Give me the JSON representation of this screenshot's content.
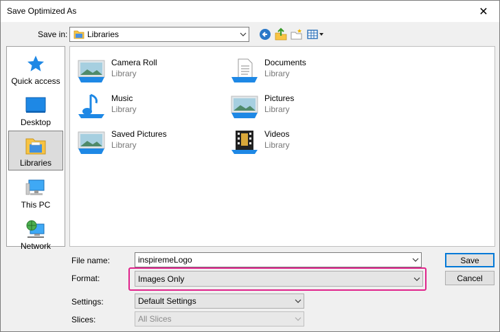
{
  "window": {
    "title": "Save Optimized As",
    "close_glyph": "✕"
  },
  "toolbar": {
    "save_in_label": "Save in:",
    "location": "Libraries",
    "icons": [
      "back-icon",
      "up-folder-icon",
      "new-folder-icon",
      "view-menu-icon"
    ]
  },
  "places": [
    {
      "label": "Quick access",
      "icon": "star-icon"
    },
    {
      "label": "Desktop",
      "icon": "desktop-icon"
    },
    {
      "label": "Libraries",
      "icon": "libraries-icon",
      "selected": true
    },
    {
      "label": "This PC",
      "icon": "computer-icon"
    },
    {
      "label": "Network",
      "icon": "network-icon"
    }
  ],
  "libraries": [
    {
      "name": "Camera Roll",
      "type": "Library",
      "icon": "picture-library-icon"
    },
    {
      "name": "Documents",
      "type": "Library",
      "icon": "documents-library-icon"
    },
    {
      "name": "Music",
      "type": "Library",
      "icon": "music-library-icon"
    },
    {
      "name": "Pictures",
      "type": "Library",
      "icon": "picture-library-icon"
    },
    {
      "name": "Saved Pictures",
      "type": "Library",
      "icon": "picture-library-icon"
    },
    {
      "name": "Videos",
      "type": "Library",
      "icon": "videos-library-icon"
    }
  ],
  "form": {
    "file_name_label": "File name:",
    "file_name_value": "inspiremeLogo",
    "format_label": "Format:",
    "format_value": "Images Only",
    "settings_label": "Settings:",
    "settings_value": "Default Settings",
    "slices_label": "Slices:",
    "slices_value": "All Slices"
  },
  "buttons": {
    "save": "Save",
    "cancel": "Cancel"
  },
  "colors": {
    "highlight": "#e0218a",
    "default_button_border": "#0078d7",
    "folder": "#f8c444"
  }
}
